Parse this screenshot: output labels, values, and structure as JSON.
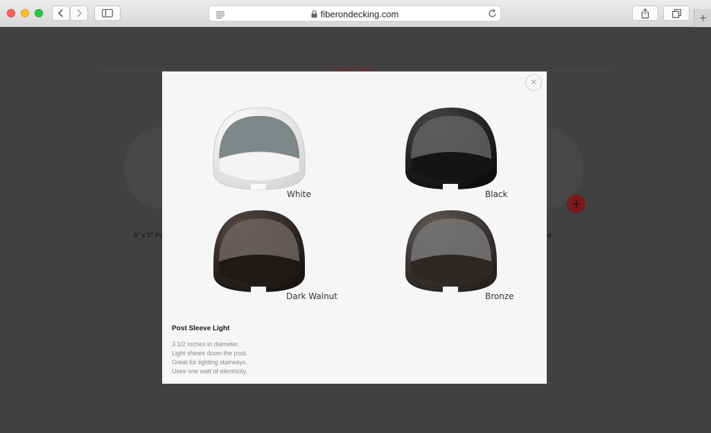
{
  "browser": {
    "url": "fiberondecking.com"
  },
  "background_page": {
    "section_heading": "LIGHTING",
    "left_product_caption": "5\" x 5\" Po",
    "right_product_caption": "ght",
    "add_button_label": "+"
  },
  "modal": {
    "close_label": "×",
    "swatches": [
      {
        "label": "White",
        "color": "#f1f1f1"
      },
      {
        "label": "Black",
        "color": "#1b1b1b"
      },
      {
        "label": "Dark Walnut",
        "color": "#2a2420"
      },
      {
        "label": "Bronze",
        "color": "#3a3633"
      }
    ],
    "product_title": "Post Sleeve Light",
    "description_lines": [
      "3 1/2 inches in diameter.",
      "Light shines down the post.",
      "Great for lighting stairways.",
      "Uses one watt of electricity."
    ]
  }
}
